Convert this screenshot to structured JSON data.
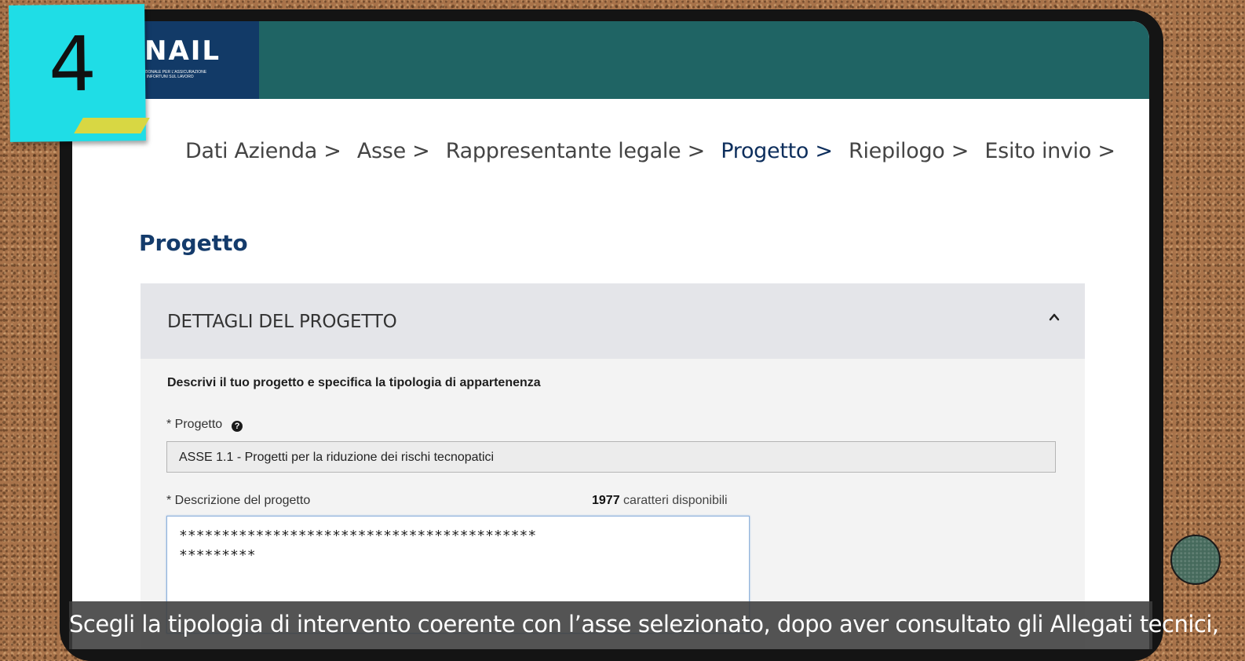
{
  "sticky_note": {
    "number": "4",
    "color": "#1fdde6"
  },
  "header": {
    "logo_text": "NAIL",
    "logo_subtitle_1": "ZIONALE PER L'ASSICURAZIONE",
    "logo_subtitle_2": "I INFORTUNI SUL LAVORO",
    "bar_color": "#1f6464",
    "logo_bg_color": "#123a67"
  },
  "breadcrumb": {
    "items": [
      {
        "label": "Dati Azienda >"
      },
      {
        "label": "Asse >"
      },
      {
        "label": "Rappresentante legale >"
      },
      {
        "label": "Progetto >"
      },
      {
        "label": "Riepilogo >"
      },
      {
        "label": "Esito invio >"
      }
    ],
    "active_index": 3
  },
  "page": {
    "title": "Progetto"
  },
  "panel": {
    "title": "DETTAGLI DEL PROGETTO",
    "intro": "Descrivi il tuo progetto e specifica la tipologia di appartenenza",
    "progetto_label": "* Progetto",
    "progetto_value": "ASSE 1.1 - Progetti per la riduzione dei rischi tecnopatici",
    "descrizione_label": "* Descrizione del progetto",
    "counter_number": "1977",
    "counter_text": "caratteri disponibili",
    "descrizione_value": "******************************************\n*********"
  },
  "subtitle": {
    "text": "Scegli la tipologia di intervento coerente con l’asse selezionato, dopo aver consultato gli Allegati tecnici,"
  }
}
